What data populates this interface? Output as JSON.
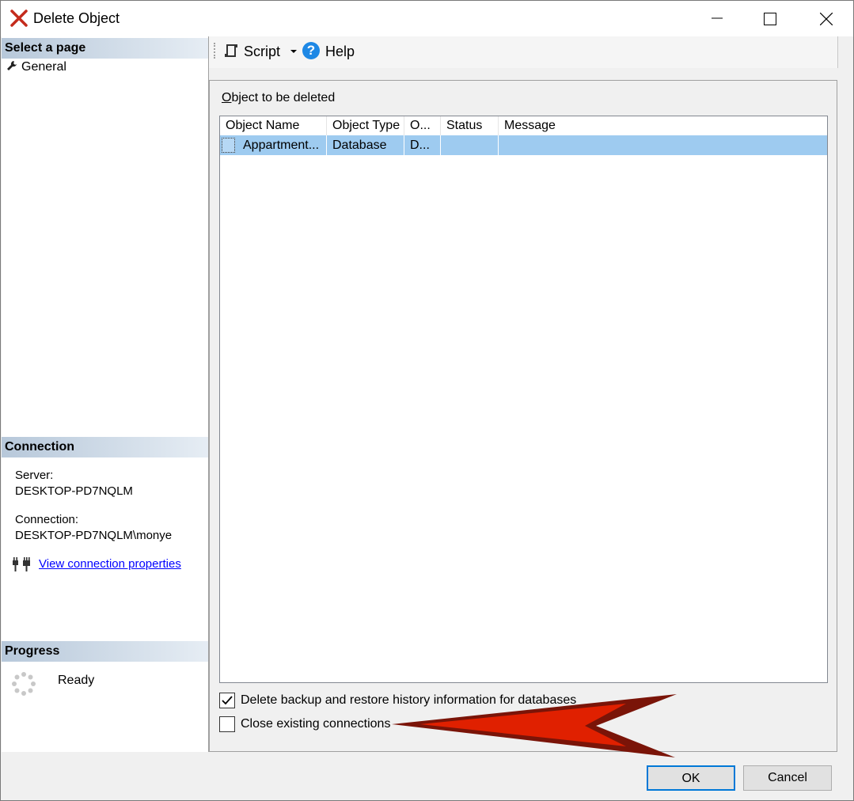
{
  "window": {
    "title": "Delete Object"
  },
  "left_pane": {
    "select_page_header": "Select a page",
    "pages": [
      {
        "label": "General",
        "icon": "wrench-icon"
      }
    ],
    "connection_header": "Connection",
    "server_label": "Server:",
    "server_value": "DESKTOP-PD7NQLM",
    "connection_label": "Connection:",
    "connection_value": "DESKTOP-PD7NQLM\\monye",
    "view_properties_link": "View connection properties",
    "progress_header": "Progress",
    "progress_status": "Ready"
  },
  "toolbar": {
    "script_label": "Script",
    "help_label": "Help"
  },
  "main": {
    "group_label_accel": "O",
    "group_label_rest": "bject to be deleted",
    "columns": [
      "Object Name",
      "Object Type",
      "O...",
      "Status",
      "Message"
    ],
    "rows": [
      {
        "object_name": "Appartment...",
        "object_type": "Database",
        "owner": "D...",
        "status": "",
        "message": ""
      }
    ],
    "options": [
      {
        "label": "Delete backup and restore history information for databases",
        "checked": true
      },
      {
        "label": "Close existing connections",
        "checked": false
      }
    ]
  },
  "buttons": {
    "ok": "OK",
    "cancel": "Cancel"
  },
  "colors": {
    "selection": "#9ecbf0",
    "link": "#0000ff",
    "annotation_arrow": "#e02000"
  }
}
